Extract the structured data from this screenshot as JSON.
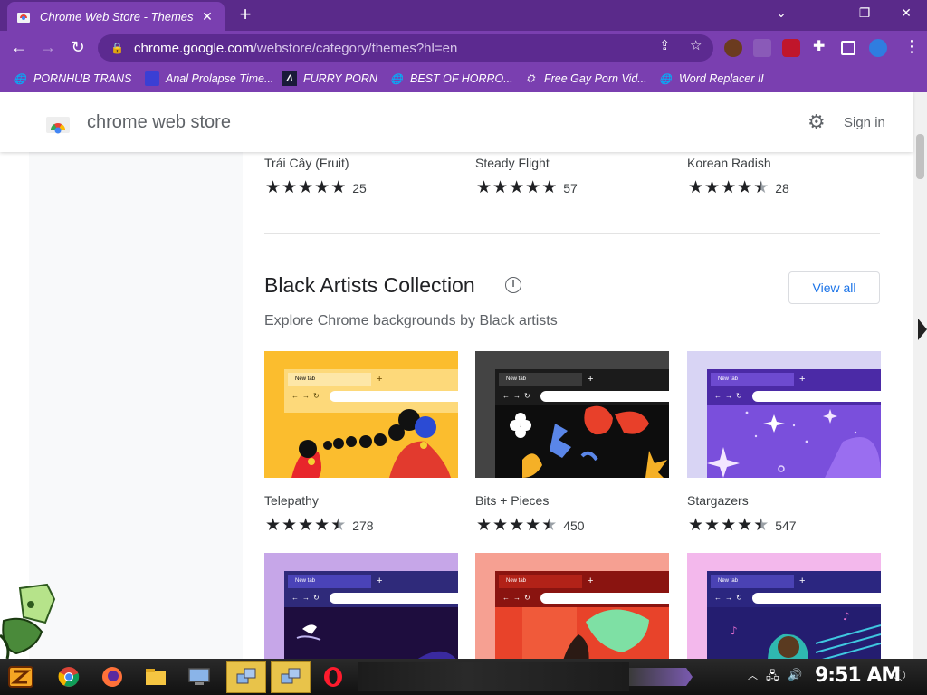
{
  "browser": {
    "tab_title": "Chrome Web Store - Themes",
    "url_host": "chrome.google.com",
    "url_path": "/webstore/category/themes?hl=en",
    "bookmarks": [
      {
        "label": "PORNHUB TRANS",
        "icon": "globe-icon"
      },
      {
        "label": "Anal Prolapse Time...",
        "icon": "site-icon"
      },
      {
        "label": "FURRY PORN",
        "icon": "a-logo-icon"
      },
      {
        "label": "BEST OF HORRO...",
        "icon": "globe-icon"
      },
      {
        "label": "Free Gay Porn Vid...",
        "icon": "site-icon"
      },
      {
        "label": "Word Replacer II",
        "icon": "globe-icon"
      }
    ],
    "theme_colors": {
      "tabbar": "#5a2a8a",
      "toolbar": "#7a3fb0"
    }
  },
  "store": {
    "title": "chrome web store",
    "sign_in": "Sign in"
  },
  "top_row": [
    {
      "name": "Trái Cây (Fruit)",
      "rating": 5,
      "count": "25"
    },
    {
      "name": "Steady Flight",
      "rating": 5,
      "count": "57"
    },
    {
      "name": "Korean Radish",
      "rating": 4.5,
      "count": "28"
    }
  ],
  "section": {
    "title": "Black Artists Collection",
    "subtitle": "Explore Chrome backgrounds by Black artists",
    "view_all": "View all"
  },
  "themes": [
    {
      "name": "Telepathy",
      "rating": 4.5,
      "count": "278",
      "colors": {
        "bg": "#fbbd2e",
        "frame": "#fdd97a",
        "tab": "#fde7a8"
      }
    },
    {
      "name": "Bits + Pieces",
      "rating": 4.5,
      "count": "450",
      "colors": {
        "bg": "#111111",
        "frame": "#2b2b2b",
        "tab": "#3a3a3a"
      }
    },
    {
      "name": "Stargazers",
      "rating": 4.5,
      "count": "547",
      "colors": {
        "bg": "#7c4ddb",
        "frame": "#5c35b8",
        "tab": "#7a55d4"
      }
    }
  ],
  "themes_row2": [
    {
      "colors": {
        "bg": "#241046",
        "frame": "#3a2a9a",
        "tab": "#5a47c8"
      }
    },
    {
      "colors": {
        "bg": "#e8432a",
        "frame": "#a81e12",
        "tab": "#c83020"
      }
    },
    {
      "colors": {
        "bg": "#2a2470",
        "frame": "#3b3590",
        "tab": "#5046b4"
      }
    }
  ],
  "thumb_label": "New tab",
  "taskbar": {
    "clock": "9:51 AM"
  }
}
